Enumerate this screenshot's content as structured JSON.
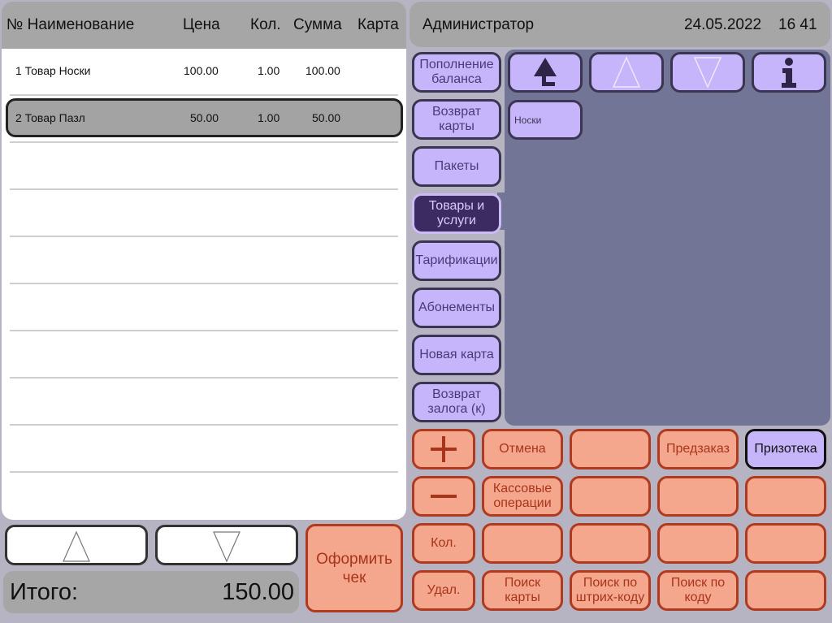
{
  "receipt": {
    "columns": {
      "name": "№ Наименование",
      "price": "Цена",
      "qty": "Кол.",
      "sum": "Сумма",
      "card": "Карта"
    },
    "rows": [
      {
        "name": "1 Товар Носки",
        "price": "100.00",
        "qty": "1.00",
        "sum": "100.00",
        "card": ""
      },
      {
        "name": "2 Товар Пазл",
        "price": "50.00",
        "qty": "1.00",
        "sum": "50.00",
        "card": ""
      }
    ]
  },
  "total": {
    "label": "Итого:",
    "value": "150.00"
  },
  "checkout": {
    "label": "Оформить чек"
  },
  "header": {
    "user": "Администратор",
    "date": "24.05.2022",
    "time": "16 41"
  },
  "categories": [
    "Пополнение баланса",
    "Возврат карты",
    "Пакеты",
    "Товары и услуги",
    "Тарификации",
    "Абонементы",
    "Новая карта",
    "Возврат залога (к)"
  ],
  "products": [
    "Носки"
  ],
  "keypad": {
    "cancel": "Отмена",
    "preorder": "Предзаказ",
    "prize_store": "Призотека",
    "cash_operations": "Кассовые операции",
    "quantity": "Кол.",
    "delete": "Удал.",
    "search_card": "Поиск карты",
    "search_barcode": "Поиск по штрих-коду",
    "search_code": "Поиск по коду"
  },
  "icons": [
    "scroll-up-icon",
    "scroll-down-icon",
    "go-top-icon",
    "page-up-icon",
    "page-down-icon",
    "info-icon",
    "plus-icon",
    "minus-icon"
  ],
  "colors": {
    "accent_purple": "#c6b5fb",
    "active_category": "#3c2a62",
    "action_orange": "#f5a78d",
    "action_text": "#a8341a",
    "panel": "#737596"
  }
}
